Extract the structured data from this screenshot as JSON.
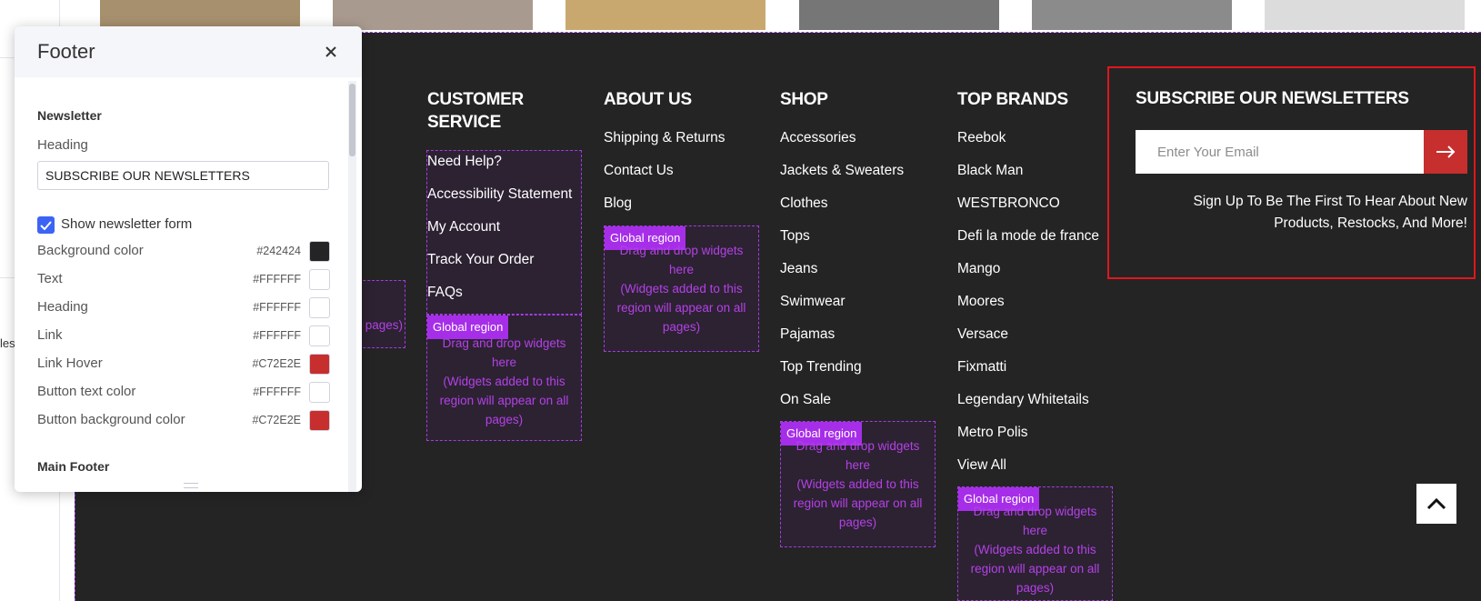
{
  "left_fragment": {
    "cut_text": "les"
  },
  "thumbnails": [
    {
      "color": "#a7906e"
    },
    {
      "color": "#a99a8f"
    },
    {
      "color": "#c9a870"
    },
    {
      "color": "#767676"
    },
    {
      "color": "#8b8b8b"
    },
    {
      "color": "#dcdcdc"
    }
  ],
  "footer": {
    "columns": [
      {
        "title": "CUSTOMER SERVICE",
        "links": [
          "Need Help?",
          "Accessibility Statement",
          "My Account",
          "Track Your Order",
          "FAQs"
        ]
      },
      {
        "title": "ABOUT US",
        "links": [
          "Shipping & Returns",
          "Contact Us",
          "Blog"
        ]
      },
      {
        "title": "SHOP",
        "links": [
          "Accessories",
          "Jackets & Sweaters",
          "Clothes",
          "Tops",
          "Jeans",
          "Swimwear",
          "Pajamas",
          "Top Trending",
          "On Sale"
        ]
      },
      {
        "title": "TOP BRANDS",
        "links": [
          "Reebok",
          "Black Man",
          "WESTBRONCO",
          "Defi la mode de france",
          "Mango",
          "Moores",
          "Versace",
          "Fixmatti",
          "Legendary Whitetails",
          "Metro Polis",
          "View All"
        ]
      }
    ],
    "global_region": {
      "badge": "Global region",
      "line1": "Drag and drop widgets",
      "line2": "here",
      "line3": "(Widgets added to this",
      "line4": "region will appear on all",
      "line5": "pages)"
    },
    "partial_region_text": "pages)",
    "newsletter": {
      "heading": "SUBSCRIBE OUR NEWSLETTERS",
      "placeholder": "Enter Your Email",
      "button_icon": "arrow-right-icon",
      "text_line1": "Sign Up To Be The First To Hear About New",
      "text_line2": "Products, Restocks, And More!"
    },
    "back_to_top_icon": "chevron-up-icon"
  },
  "panel": {
    "title": "Footer",
    "close_icon": "close-icon",
    "section": "Newsletter",
    "heading_label": "Heading",
    "heading_value": "SUBSCRIBE OUR NEWSLETTERS",
    "show_form_label": "Show newsletter form",
    "show_form_checked": true,
    "colors": [
      {
        "label": "Background color",
        "hex": "#242424"
      },
      {
        "label": "Text",
        "hex": "#FFFFFF"
      },
      {
        "label": "Heading",
        "hex": "#FFFFFF"
      },
      {
        "label": "Link",
        "hex": "#FFFFFF"
      },
      {
        "label": "Link Hover",
        "hex": "#C72E2E"
      },
      {
        "label": "Button text color",
        "hex": "#FFFFFF"
      },
      {
        "label": "Button background color",
        "hex": "#C72E2E"
      }
    ],
    "next_section": "Main Footer"
  }
}
